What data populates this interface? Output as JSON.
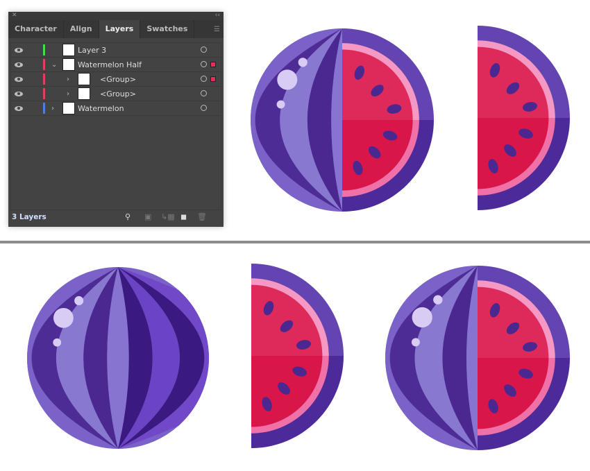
{
  "panel": {
    "tabs": [
      {
        "label": "Character"
      },
      {
        "label": "Align"
      },
      {
        "label": "Layers",
        "active": true
      },
      {
        "label": "Swatches"
      }
    ],
    "layers": [
      {
        "name": "Layer 3",
        "color": "#4cd94c",
        "indent": 0,
        "expand": "",
        "selected": false
      },
      {
        "name": "Watermelon Half",
        "color": "#e0405a",
        "indent": 0,
        "expand": "⌄",
        "selected": true
      },
      {
        "name": "<Group>",
        "color": "#e0405a",
        "indent": 1,
        "expand": "›",
        "selected": true
      },
      {
        "name": "<Group>",
        "color": "#e0405a",
        "indent": 1,
        "expand": "›",
        "selected": false
      },
      {
        "name": "Watermelon",
        "color": "#4a7fe0",
        "indent": 0,
        "expand": "›",
        "selected": false
      }
    ],
    "footer": {
      "count": "3 Layers"
    }
  },
  "colors": {
    "purple_light": "#8674d0",
    "purple_dark": "#4a2890",
    "red_top": "#de2a5a",
    "red_bottom": "#d8164a",
    "pink": "#f070a8",
    "rind_top": "#6444b0",
    "rind_bottom": "#4c2a9a"
  }
}
